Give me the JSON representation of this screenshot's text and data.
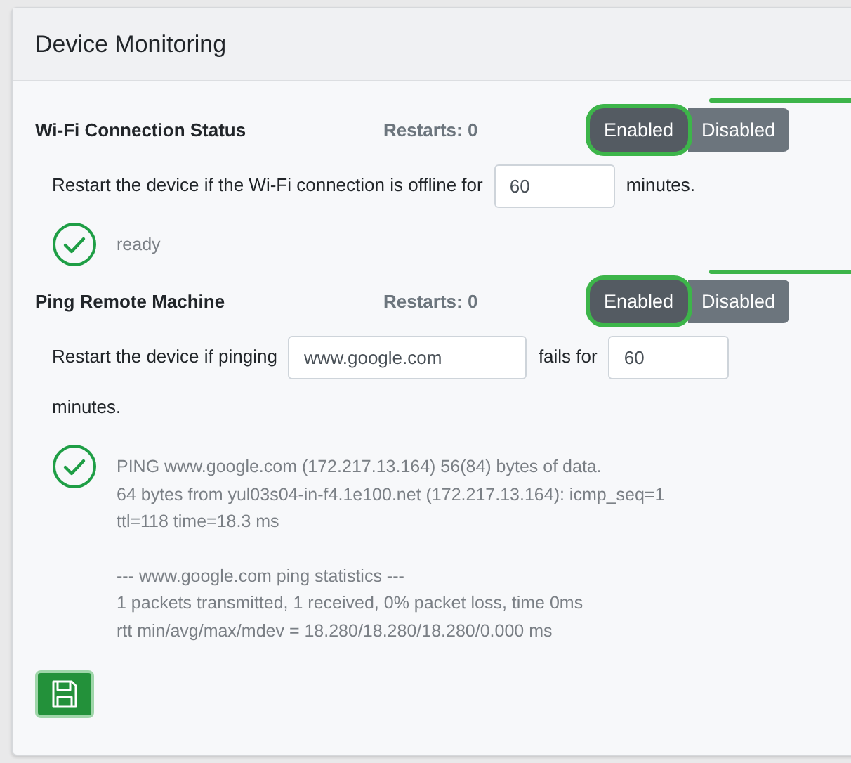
{
  "card": {
    "title": "Device Monitoring"
  },
  "sections": [
    {
      "title": "Wi-Fi Connection Status",
      "restarts": "Restarts: 0",
      "toggle": [
        {
          "label": "Enabled",
          "selected": true,
          "highlighted": true
        },
        {
          "label": "Disabled",
          "selected": false,
          "highlighted": false
        }
      ],
      "rule": [
        {
          "kind": "text",
          "text": "Restart the device if the Wi-Fi connection is offline for"
        },
        {
          "kind": "field",
          "value": "60",
          "wide": false
        },
        {
          "kind": "text",
          "text": "minutes."
        }
      ],
      "status": {
        "ok": true,
        "blocks": [
          [
            "ready"
          ]
        ]
      }
    },
    {
      "title": "Ping Remote Machine",
      "restarts": "Restarts: 0",
      "toggle": [
        {
          "label": "Enabled",
          "selected": true,
          "highlighted": true
        },
        {
          "label": "Disabled",
          "selected": false,
          "highlighted": false
        }
      ],
      "rule": [
        {
          "kind": "text",
          "text": "Restart the device if pinging"
        },
        {
          "kind": "field",
          "value": "www.google.com",
          "wide": true
        },
        {
          "kind": "text",
          "text": "fails for"
        },
        {
          "kind": "field",
          "value": "60",
          "wide": false
        },
        {
          "kind": "text",
          "text": "minutes."
        }
      ],
      "status": {
        "ok": true,
        "blocks": [
          [
            "PING www.google.com (172.217.13.164) 56(84) bytes of data.",
            "64 bytes from yul03s04-in-f4.1e100.net (172.217.13.164): icmp_seq=1",
            "ttl=118 time=18.3 ms"
          ],
          [
            "--- www.google.com ping statistics ---",
            "1 packets transmitted, 1 received, 0% packet loss, time 0ms",
            "rtt min/avg/max/mdev = 18.280/18.280/18.280/0.000 ms"
          ]
        ]
      }
    }
  ],
  "save_button": {
    "kind": "save"
  }
}
